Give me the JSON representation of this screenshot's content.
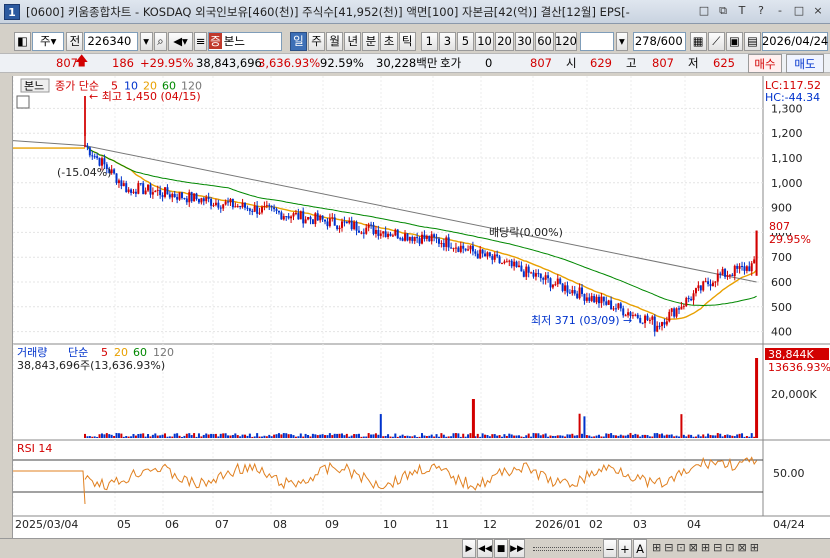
{
  "window": {
    "title": "[0600] 키움종합차트 - KOSDAQ 외국인보유[460(천)] 주식수[41,952(천)] 액면[100] 자본금[42(억)] 결산[12월] EPS[-",
    "badge": "1",
    "controls": [
      "□",
      "⧉",
      "T",
      "?",
      "-",
      "□",
      "×"
    ]
  },
  "toolbar": {
    "market": "주",
    "prefix": "전",
    "code": "226340",
    "stock_tag": "증",
    "stock_name": "본느",
    "periods": [
      "일",
      "주",
      "월",
      "년",
      "분",
      "초",
      "틱"
    ],
    "active_period": "일",
    "intervals": [
      "1",
      "3",
      "5",
      "10",
      "20",
      "30",
      "60",
      "120"
    ],
    "count": "278",
    "count_total": "/600",
    "date": "2026/04/24"
  },
  "quote": {
    "price": "807",
    "change": "186",
    "change_pct": "+29.95%",
    "volume": "38,843,696",
    "volume_pct": "3,636.93%",
    "turnover": "92.59%",
    "amount": "30,228백만",
    "hoga_label": "호가",
    "hoga": "0",
    "hoga_price": "807",
    "open_label": "시",
    "open": "629",
    "high_label": "고",
    "high": "807",
    "low_label": "저",
    "low": "625",
    "buy": "매수",
    "sell": "매도"
  },
  "price_panel": {
    "name_tag": "본느",
    "legend_label": "종가 단순",
    "ma": [
      "5",
      "10",
      "20",
      "60",
      "120"
    ],
    "ma_colors": [
      "#d20000",
      "#0033cc",
      "#e8a000",
      "#008800",
      "#777777"
    ],
    "lc": "LC:117.52",
    "hc": "HC:-44.34",
    "high_annot": "최고 1,450 (04/15)",
    "pct_annot": "(-15.04%)",
    "div_annot": "배당락(0.00%)",
    "low_annot": "최저 371 (03/09)",
    "last_price": "807",
    "last_pct": "29.95%",
    "y_ticks": [
      "1,300",
      "1,200",
      "1,100",
      "1,000",
      "900",
      "800",
      "700",
      "600",
      "500",
      "400"
    ]
  },
  "volume_panel": {
    "legend_label": "거래량",
    "legend_sub": "단순",
    "ma": [
      "5",
      "20",
      "60",
      "120"
    ],
    "info": "38,843,696주(13,636.93%)",
    "last": "38,844K",
    "last_pct": "13636.93%",
    "y_ticks": [
      "20,000K"
    ]
  },
  "rsi_panel": {
    "legend": "RSI 14",
    "y_ticks": [
      "50.00"
    ]
  },
  "x_axis": {
    "labels": [
      "2025/03/04",
      "05",
      "06",
      "07",
      "08",
      "09",
      "10",
      "11",
      "12",
      "2026/01",
      "02",
      "03",
      "04"
    ],
    "end_label": "04/24"
  },
  "bottom": {
    "nav": [
      "▶",
      "◀◀",
      "■",
      "▶▶"
    ],
    "zoom": [
      "−",
      "+",
      "A"
    ]
  },
  "colors": {
    "up": "#d20000",
    "down": "#0033cc",
    "accent": "#3d6fb6"
  }
}
